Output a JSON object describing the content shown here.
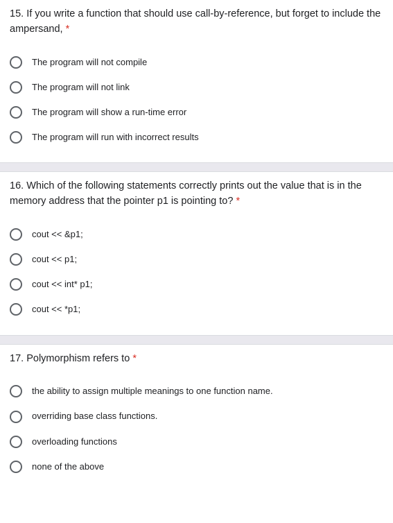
{
  "questions": [
    {
      "number": "15.",
      "text": "If you write a function that should use call-by-reference, but forget to include the ampersand,",
      "required": "*",
      "options": [
        "The program will not compile",
        "The program will not link",
        "The program will show a run-time error",
        "The program will run with incorrect results"
      ]
    },
    {
      "number": "16.",
      "text": "Which of the following statements correctly prints out the value that is in the memory address that the pointer p1 is pointing to?",
      "required": "*",
      "options": [
        "cout << &p1;",
        "cout << p1;",
        "cout << int* p1;",
        "cout << *p1;"
      ]
    },
    {
      "number": "17.",
      "text": "Polymorphism refers to",
      "required": "*",
      "options": [
        "the ability to assign multiple meanings to one function name.",
        "overriding base class functions.",
        "overloading functions",
        "none of the above"
      ]
    }
  ]
}
